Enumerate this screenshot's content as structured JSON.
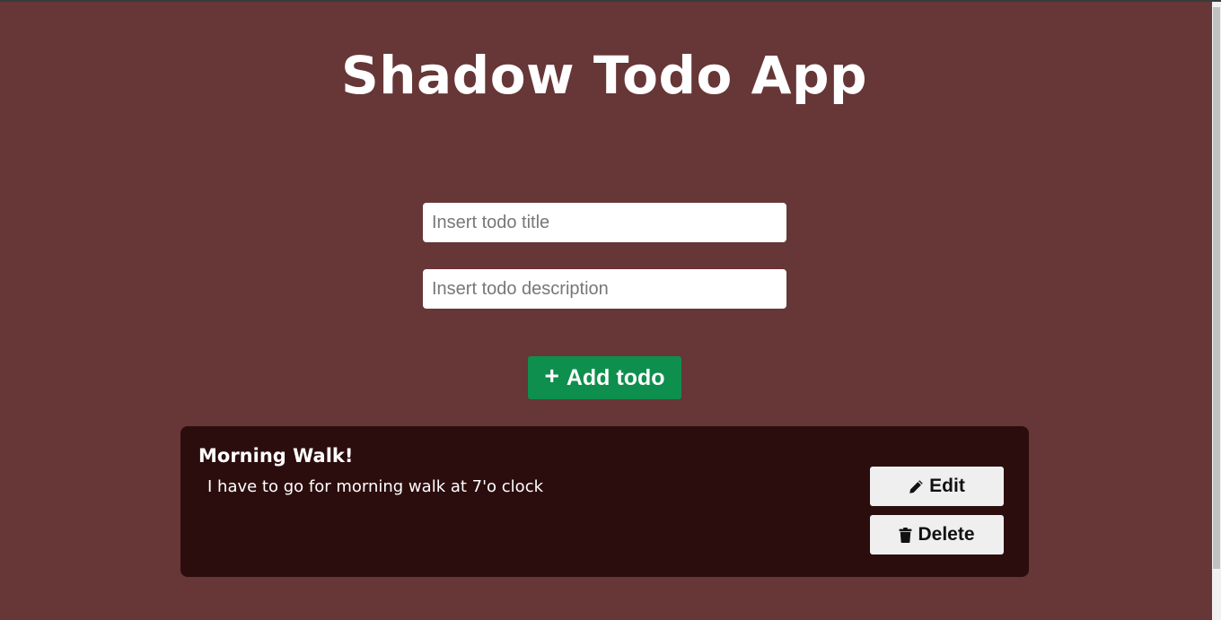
{
  "app": {
    "title": "Shadow Todo App"
  },
  "form": {
    "title_placeholder": "Insert todo title",
    "description_placeholder": "Insert todo description",
    "title_value": "",
    "description_value": "",
    "add_button_label": "Add todo",
    "add_button_icon": "plus-icon"
  },
  "todos": [
    {
      "title": "Morning Walk!",
      "description": "I have to go for morning walk at 7'o clock",
      "edit_label": "Edit",
      "edit_icon": "pencil-icon",
      "delete_label": "Delete",
      "delete_icon": "trash-icon"
    }
  ],
  "colors": {
    "background": "#673637",
    "card": "#2c0d0d",
    "accent": "#0e8f4d",
    "button": "#efefef"
  }
}
